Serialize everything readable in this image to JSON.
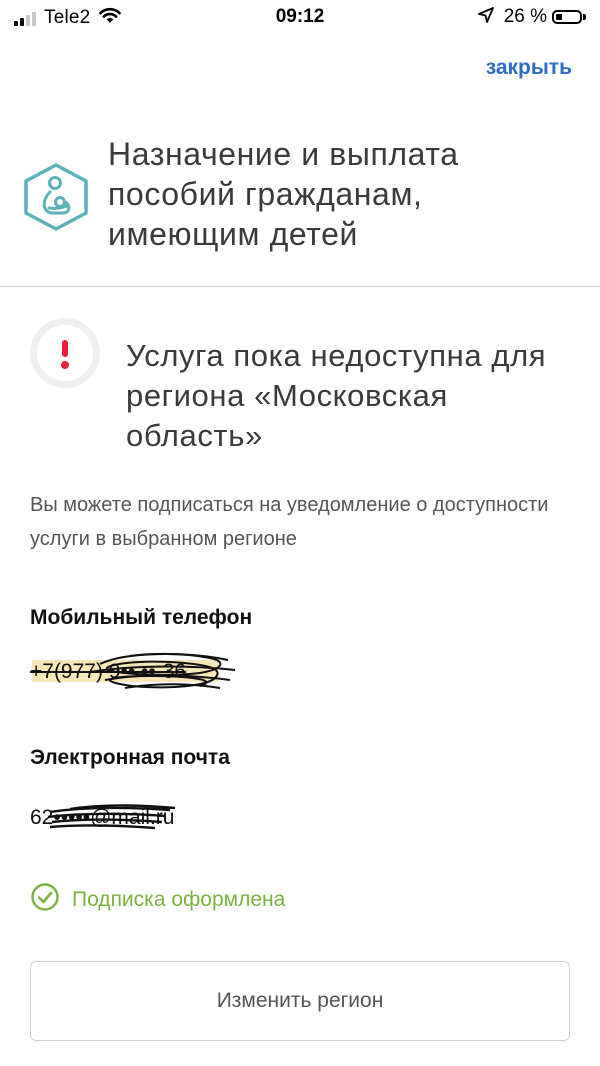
{
  "status_bar": {
    "carrier": "Tele2",
    "time": "09:12",
    "battery_percent": "26 %",
    "battery_level": 0.26,
    "icons": [
      "signal-icon",
      "wifi-icon",
      "location-arrow-icon",
      "battery-icon"
    ]
  },
  "header": {
    "close_label": "закрыть"
  },
  "service": {
    "title": "Назначение и выплата пособий гражданам, имеющим детей",
    "icon": "mother-child-icon",
    "icon_color": "#5BB3B9"
  },
  "notice": {
    "icon": "exclamation-icon",
    "icon_color": "#E8203A",
    "title": "Услуга пока недоступна для региона «Московская область»",
    "hint": "Вы можете подписаться на уведомление о доступности услуги в выбранном регионе"
  },
  "form": {
    "phone_label": "Мобильный телефон",
    "phone_value": "+7(977) 9•• ••-36",
    "email_label": "Электронная почта",
    "email_value": "62•••••@mail.ru"
  },
  "subscription": {
    "icon": "check-circle-icon",
    "status_label": "Подписка оформлена",
    "status_color": "#7BB33F"
  },
  "actions": {
    "change_region_label": "Изменить регион"
  },
  "colors": {
    "accent_link": "#2E6DC4",
    "warning": "#E8203A",
    "success": "#7BB33F",
    "service_icon": "#5BB3B9"
  }
}
